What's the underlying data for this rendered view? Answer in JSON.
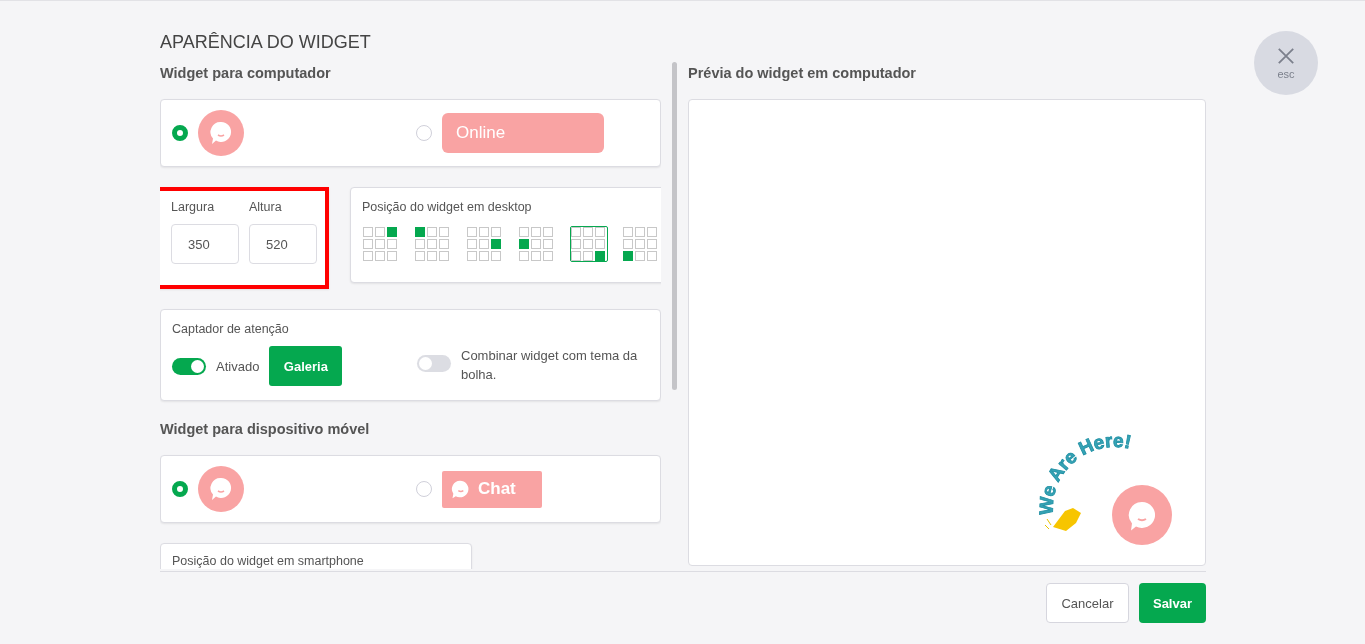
{
  "title": "APARÊNCIA DO WIDGET",
  "desktop": {
    "heading": "Widget para computador",
    "styles": [
      {
        "kind": "bubble",
        "selected": true
      },
      {
        "kind": "bar",
        "label": "Online",
        "selected": false
      }
    ],
    "size": {
      "highlighted": true,
      "width_label": "Largura",
      "width_value": "350",
      "height_label": "Altura",
      "height_value": "520"
    },
    "position": {
      "label": "Posição do widget em desktop",
      "options": [
        {
          "kind": "top-right",
          "selected": false
        },
        {
          "kind": "top-left",
          "selected": false
        },
        {
          "kind": "middle-right",
          "selected": false
        },
        {
          "kind": "middle-left",
          "selected": false
        },
        {
          "kind": "bottom-right",
          "selected": true
        },
        {
          "kind": "bottom-left",
          "selected": false
        }
      ]
    },
    "attention": {
      "label": "Captador de atenção",
      "toggle": {
        "label": "Ativado",
        "on": true
      },
      "gallery_button": "Galeria",
      "match": {
        "label": "Combinar widget com tema da bolha.",
        "on": false
      }
    }
  },
  "mobile": {
    "heading": "Widget para dispositivo móvel",
    "styles": [
      {
        "kind": "bubble",
        "selected": true
      },
      {
        "kind": "chat",
        "label": "Chat",
        "selected": false
      }
    ],
    "position_label": "Posição do widget em smartphone"
  },
  "preview": {
    "heading": "Prévia do widget em computador",
    "bubble_text": "We Are Here!"
  },
  "buttons": {
    "cancel": "Cancelar",
    "save": "Salvar"
  },
  "close": {
    "label": "esc"
  }
}
